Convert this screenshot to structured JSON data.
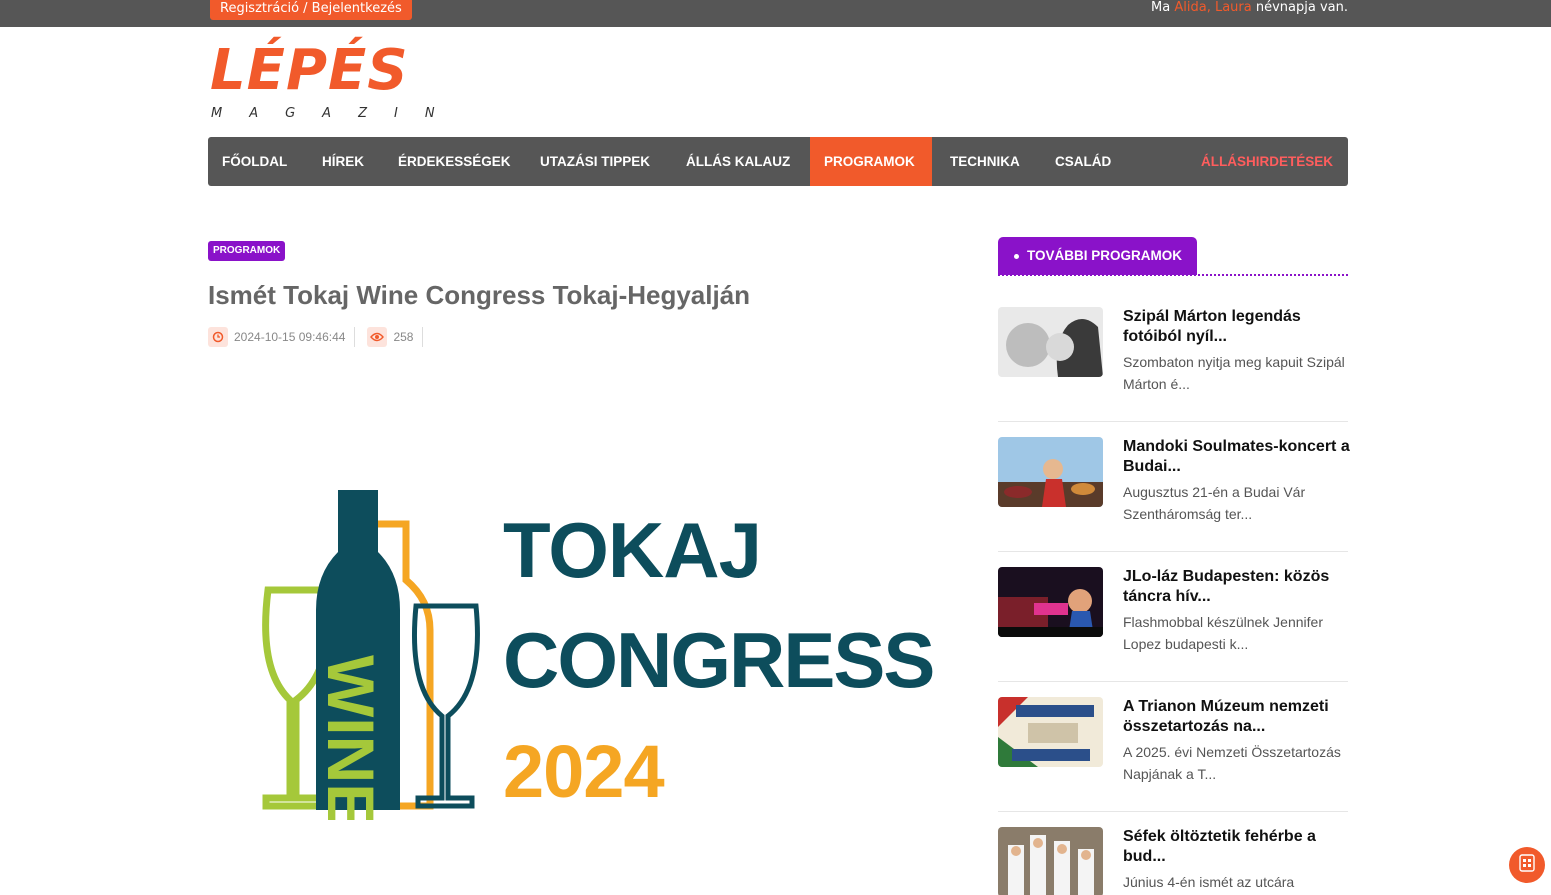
{
  "topbar": {
    "auth_label": "Regisztráció / Bejelentkezés",
    "nameday_prefix": "Ma ",
    "nameday_names": "Alida, Laura",
    "nameday_suffix": " névnapja van."
  },
  "logo": {
    "main": "LÉPÉS",
    "sub": "MAGAZIN"
  },
  "nav": {
    "items": [
      "FŐOLDAL",
      "HÍREK",
      "ÉRDEKESSÉGEK",
      "UTAZÁSI TIPPEK",
      "ÁLLÁS KALAUZ",
      "PROGRAMOK",
      "TECHNIKA",
      "CSALÁD"
    ],
    "active": "PROGRAMOK",
    "jobs_label": "ÁLLÁSHIRDETÉSEK"
  },
  "article": {
    "category": "PROGRAMOK",
    "title": "Ismét Tokaj Wine Congress Tokaj-Hegyalján",
    "date": "2024-10-15 09:46:44",
    "views": "258",
    "hero": {
      "line1": "TOKAJ",
      "line2": "CONGRESS",
      "line3": "2024",
      "wine_word": "WINE"
    }
  },
  "sidebar": {
    "heading": "TOVÁBBI PROGRAMOK",
    "posts": [
      {
        "title": "Szipál Márton legendás fotóiból nyíl...",
        "desc": "Szombaton nyitja meg kapuit Szipál Márton é..."
      },
      {
        "title": "Mandoki Soulmates-koncert a Budai...",
        "desc": "Augusztus 21-én a Budai Vár Szentháromság ter..."
      },
      {
        "title": "JLo-láz Budapesten: közös táncra hív...",
        "desc": "Flashmobbal készülnek Jennifer Lopez budapesti k..."
      },
      {
        "title": "A Trianon Múzeum nemzeti összetartozás na...",
        "desc": "A 2025. évi Nemzeti Összetartozás Napjának a T..."
      },
      {
        "title": "Séfek öltöztetik fehérbe a bud...",
        "desc": "Június 4-én ismét az utcára"
      }
    ]
  },
  "colors": {
    "accent": "#f15a2b",
    "nav_bg": "#565656",
    "category": "#8a12c9",
    "wine_teal": "#0d4d5c",
    "wine_gold": "#f5a623",
    "wine_green": "#a5c83a"
  },
  "icons": {
    "date": "clock-icon",
    "views": "eye-icon",
    "float": "widget-icon"
  }
}
